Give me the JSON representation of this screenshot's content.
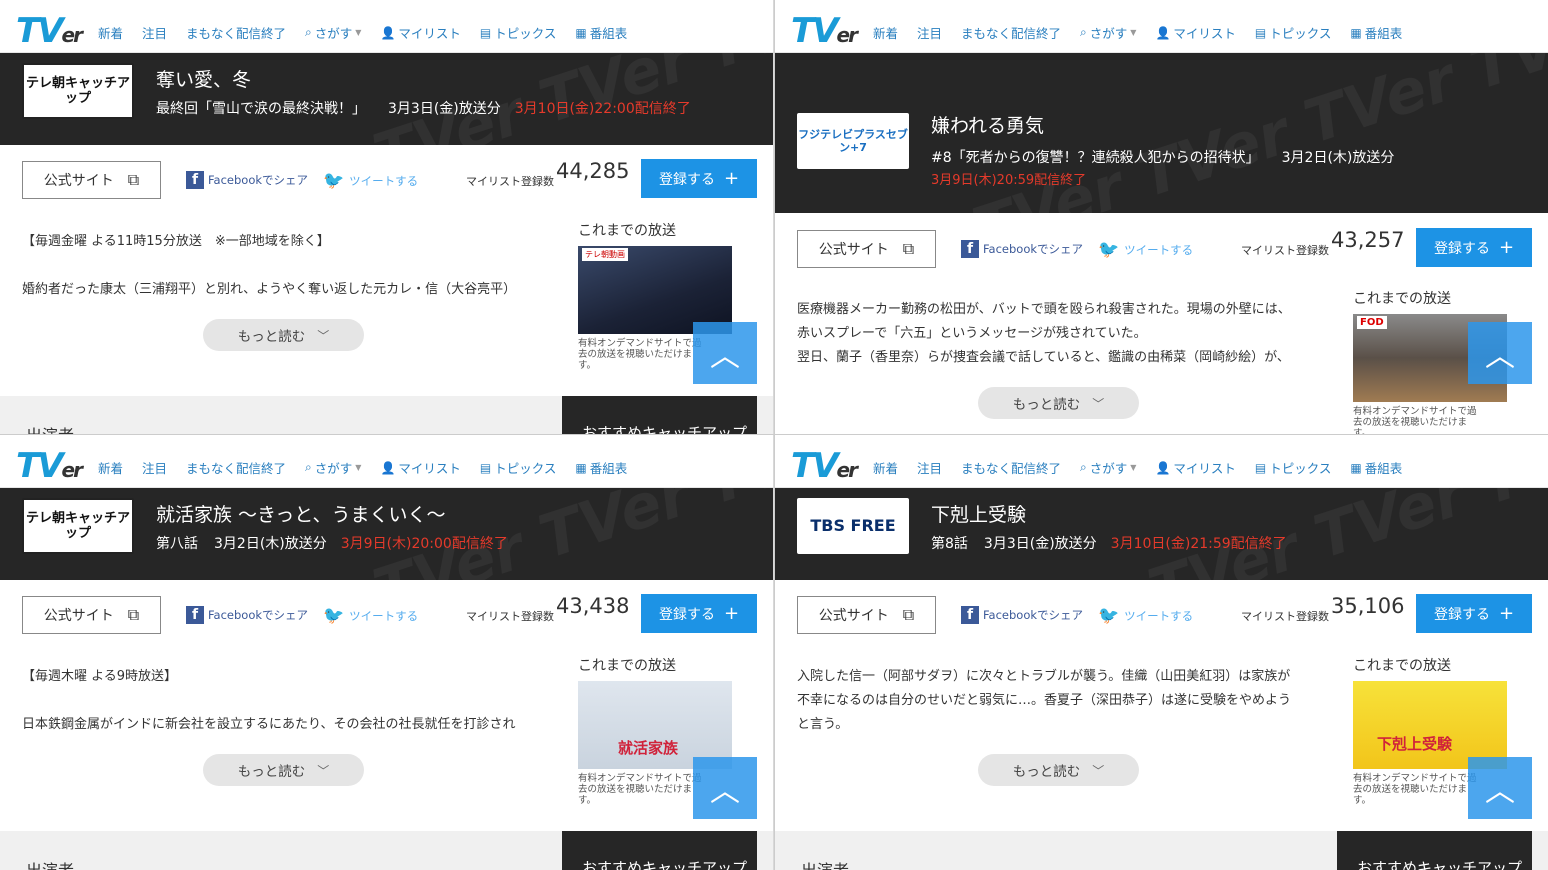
{
  "nav": {
    "logo_main": "TV",
    "logo_tail": "er",
    "items": [
      "新着",
      "注目",
      "まもなく配信終了",
      "さがす",
      "マイリスト",
      "トピックス",
      "番組表"
    ]
  },
  "common": {
    "official_site": "公式サイト",
    "facebook_share": "Facebookでシェア",
    "tweet": "ツイートする",
    "mylist_label": "マイリスト登録数",
    "register": "登録する",
    "read_more": "もっと読む",
    "past_broadcasts": "これまでの放送",
    "thumb_note": "有料オンデマンドサイトで過去の放送を視聴いただけます。",
    "cast": "出演者",
    "recommended": "おすすめキャッチアップ"
  },
  "panels": [
    {
      "channel_logo": "テレ朝キャッチアップ",
      "title": "奪い愛、冬",
      "episode": "最終回「雪山で涙の最終決戦！」",
      "air_date": "3月3日(金)放送分",
      "end_date": "3月10日(金)22:00配信終了",
      "mylist_count": "44,285",
      "desc_lines": [
        "【毎週金曜 よる11時15分放送　※一部地域を除く】",
        "",
        "婚約者だった康太（三浦翔平）と別れ、ようやく奪い返した元カレ・信（大谷亮平）"
      ],
      "thumb_text": "テレ朝動画"
    },
    {
      "channel_logo": "フジテレビプラスセブン+7",
      "title": "嫌われる勇気",
      "episode": "#8「死者からの復讐！？連続殺人犯からの招待状」",
      "air_date": "3月2日(木)放送分",
      "end_date": "3月9日(木)20:59配信終了",
      "mylist_count": "43,257",
      "desc_lines": [
        "医療機器メーカー勤務の松田が、バットで頭を殴られ殺害された。現場の外壁には、",
        "赤いスプレーで「六五」というメッセージが残されていた。",
        "翌日、蘭子（香里奈）らが捜査会議で話していると、鑑識の由稀菜（岡崎紗絵）が、"
      ],
      "thumb_text": "FOD"
    },
    {
      "channel_logo": "テレ朝キャッチアップ",
      "title": "就活家族 ～きっと、うまくいく～",
      "episode": "第八話",
      "air_date": "3月2日(木)放送分",
      "end_date": "3月9日(木)20:00配信終了",
      "mylist_count": "43,438",
      "desc_lines": [
        "【毎週木曜 よる9時放送】",
        "",
        "日本鉄鋼金属がインドに新会社を設立するにあたり、その会社の社長就任を打診され"
      ],
      "thumb_text": "就活家族"
    },
    {
      "channel_logo": "TBS FREE",
      "title": "下剋上受験",
      "episode": "第8話",
      "air_date": "3月3日(金)放送分",
      "end_date": "3月10日(金)21:59配信終了",
      "mylist_count": "35,106",
      "desc_lines": [
        "入院した信一（阿部サダヲ）に次々とトラブルが襲う。佳織（山田美紅羽）は家族が",
        "不幸になるのは自分のせいだと弱気に…。香夏子（深田恭子）は遂に受験をやめよう",
        "と言う。"
      ],
      "thumb_text": "下剋上受験"
    }
  ],
  "colors": {
    "accent": "#1d93e5",
    "nav_text": "#2a7fbf",
    "hero_bg": "#262626",
    "end_red": "#e53a2b",
    "facebook": "#3b5998",
    "twitter": "#55acee"
  }
}
